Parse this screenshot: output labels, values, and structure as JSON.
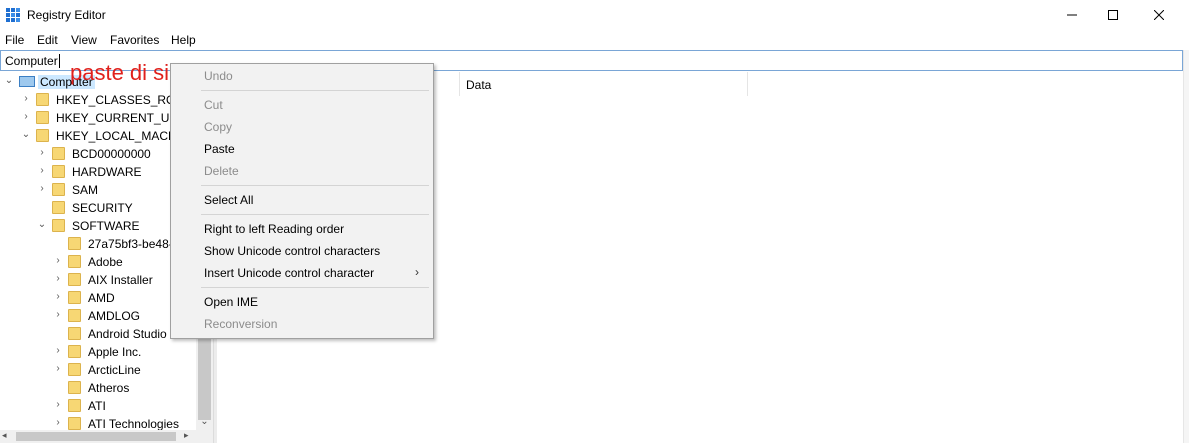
{
  "window": {
    "title": "Registry Editor",
    "controls": {
      "minimize": "minimize-icon",
      "maximize": "maximize-icon",
      "close": "close-icon"
    }
  },
  "menu": {
    "items": [
      "File",
      "Edit",
      "View",
      "Favorites",
      "Help"
    ]
  },
  "address": {
    "value": "Computer"
  },
  "annotation": {
    "text": "paste di sini",
    "color": "#e0201c"
  },
  "tree": {
    "root": "Computer",
    "hives": [
      "HKEY_CLASSES_ROOT",
      "HKEY_CURRENT_USER",
      "HKEY_LOCAL_MACHINE"
    ],
    "hklm_children": [
      "BCD00000000",
      "HARDWARE",
      "SAM",
      "SECURITY",
      "SOFTWARE"
    ],
    "software_children": [
      "27a75bf3-be48-",
      "Adobe",
      "AIX Installer",
      "AMD",
      "AMDLOG",
      "Android Studio",
      "Apple Inc.",
      "ArcticLine",
      "Atheros",
      "ATI",
      "ATI Technologies"
    ]
  },
  "columns": {
    "data": "Data"
  },
  "context_menu": {
    "items": {
      "undo": "Undo",
      "cut": "Cut",
      "copy": "Copy",
      "paste": "Paste",
      "delete": "Delete",
      "select_all": "Select All",
      "rtl": "Right to left Reading order",
      "show_unicode": "Show Unicode control characters",
      "insert_unicode": "Insert Unicode control character",
      "open_ime": "Open IME",
      "reconversion": "Reconversion"
    },
    "disabled": [
      "Undo",
      "Cut",
      "Copy",
      "Delete",
      "Reconversion"
    ]
  },
  "colors": {
    "folder": "#f7d774",
    "selection": "#cce8ff",
    "address_border": "#7aa6d6",
    "menu_bg": "#f2f2f2"
  }
}
